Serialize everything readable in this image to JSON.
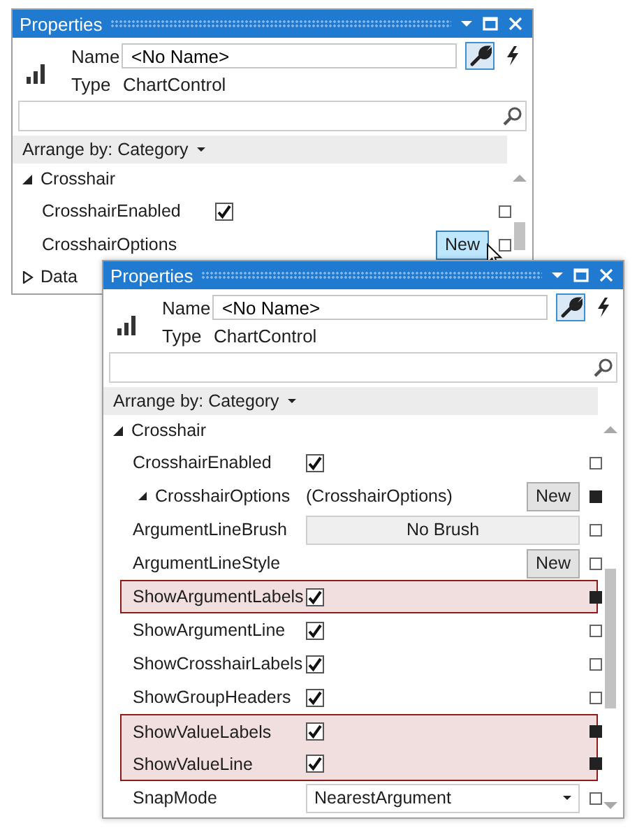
{
  "windows": [
    {
      "title": "Properties",
      "name_label": "Name",
      "name_value": "<No Name>",
      "type_label": "Type",
      "type_value": "ChartControl",
      "views": [
        {
          "kind": "properties",
          "selected": true
        },
        {
          "kind": "events",
          "selected": false
        }
      ],
      "arrange": "Arrange by: Category",
      "categories": [
        {
          "name": "Crosshair",
          "expanded": true,
          "properties": [
            {
              "kind": "checkbox",
              "name": "CrosshairEnabled",
              "checked": true,
              "modified": false,
              "highlighted": false
            },
            {
              "kind": "new",
              "name": "CrosshairOptions",
              "button": "New",
              "hovered": true,
              "modified": false,
              "highlighted": false
            }
          ]
        },
        {
          "name": "Data",
          "expanded": false
        }
      ]
    },
    {
      "title": "Properties",
      "name_label": "Name",
      "name_value": "<No Name>",
      "type_label": "Type",
      "type_value": "ChartControl",
      "views": [
        {
          "kind": "properties",
          "selected": true
        },
        {
          "kind": "events",
          "selected": false
        }
      ],
      "arrange": "Arrange by: Category",
      "categories": [
        {
          "name": "Crosshair",
          "expanded": true,
          "properties": [
            {
              "kind": "checkbox",
              "name": "CrosshairEnabled",
              "checked": true,
              "modified": false,
              "highlighted": false
            },
            {
              "kind": "object",
              "name": "CrosshairOptions",
              "value": "(CrosshairOptions)",
              "button": "New",
              "hovered": false,
              "expanded": true,
              "modified": true,
              "highlighted": false,
              "children": [
                {
                  "kind": "brush",
                  "name": "ArgumentLineBrush",
                  "value": "No Brush",
                  "modified": false,
                  "highlighted": false
                },
                {
                  "kind": "new",
                  "name": "ArgumentLineStyle",
                  "button": "New",
                  "hovered": false,
                  "modified": false,
                  "highlighted": false
                },
                {
                  "kind": "checkbox",
                  "name": "ShowArgumentLabels",
                  "checked": true,
                  "modified": true,
                  "highlighted": true
                },
                {
                  "kind": "checkbox",
                  "name": "ShowArgumentLine",
                  "checked": true,
                  "modified": false,
                  "highlighted": false
                },
                {
                  "kind": "checkbox",
                  "name": "ShowCrosshairLabels",
                  "checked": true,
                  "modified": false,
                  "highlighted": false
                },
                {
                  "kind": "checkbox",
                  "name": "ShowGroupHeaders",
                  "checked": true,
                  "modified": false,
                  "highlighted": false
                },
                {
                  "kind": "checkbox",
                  "name": "ShowValueLabels",
                  "checked": true,
                  "modified": true,
                  "highlighted": true
                },
                {
                  "kind": "checkbox",
                  "name": "ShowValueLine",
                  "checked": true,
                  "modified": true,
                  "highlighted": true
                },
                {
                  "kind": "combo",
                  "name": "SnapMode",
                  "value": "NearestArgument",
                  "modified": false,
                  "highlighted": false
                }
              ]
            }
          ]
        }
      ]
    }
  ]
}
